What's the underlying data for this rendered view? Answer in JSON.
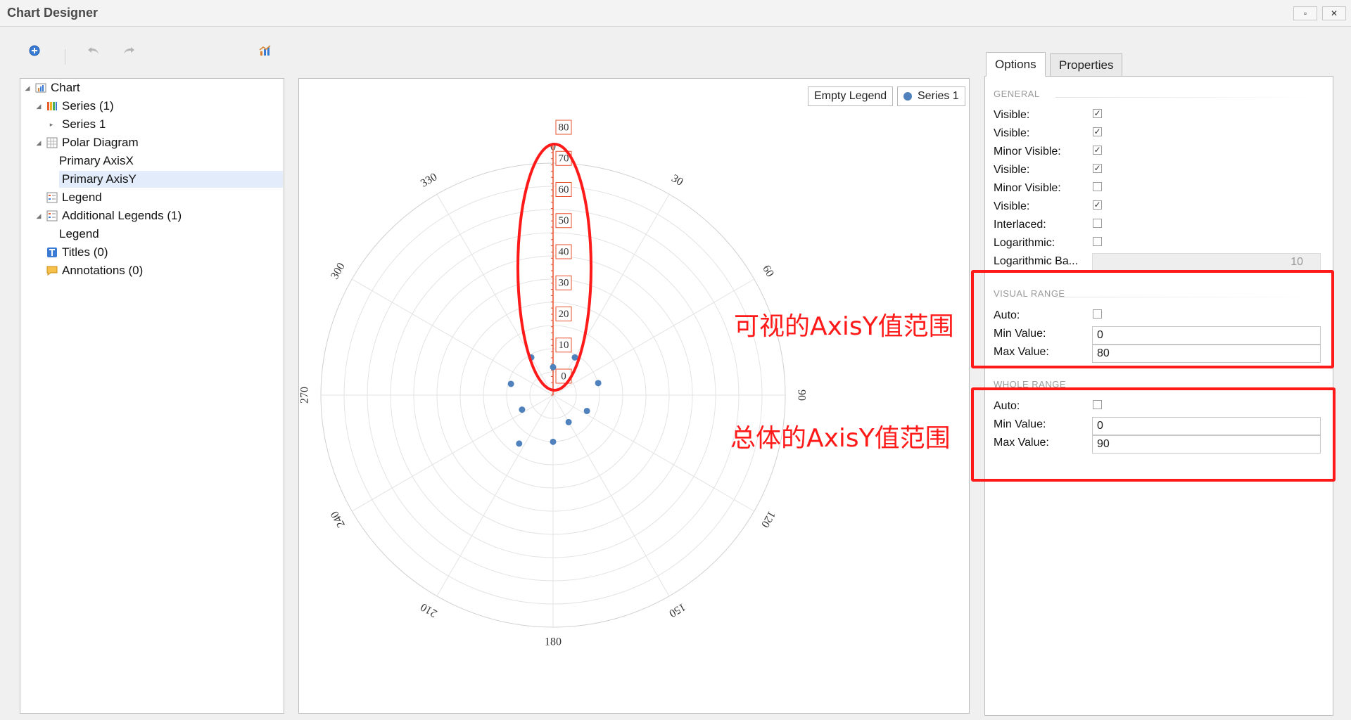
{
  "window": {
    "title": "Chart Designer",
    "restore_glyph": "▫",
    "close_glyph": "✕"
  },
  "toolbar": {
    "icons": [
      "add-icon",
      "undo-icon",
      "redo-icon",
      "chart-wizard-icon"
    ]
  },
  "tree": {
    "items": [
      {
        "label": "Chart",
        "icon": "chart-icon"
      },
      {
        "label": "Series (1)",
        "icon": "series-icon"
      },
      {
        "label": "Series 1",
        "icon": ""
      },
      {
        "label": "Polar Diagram",
        "icon": "diagram-icon"
      },
      {
        "label": "Primary AxisX",
        "icon": ""
      },
      {
        "label": "Primary AxisY",
        "icon": "",
        "selected": true
      },
      {
        "label": "Legend",
        "icon": "legend-icon"
      },
      {
        "label": "Additional Legends (1)",
        "icon": "legend-icon"
      },
      {
        "label": "Legend",
        "icon": ""
      },
      {
        "label": "Titles (0)",
        "icon": "title-icon"
      },
      {
        "label": "Annotations (0)",
        "icon": "annotation-icon"
      }
    ]
  },
  "chart": {
    "empty_legend": "Empty Legend",
    "series_legend": "Series 1",
    "series_color": "#4f81bd"
  },
  "chart_data": {
    "type": "scatter",
    "coordinate_system": "polar",
    "angle_labels": [
      "0",
      "30",
      "60",
      "90",
      "120",
      "150",
      "180",
      "210",
      "240",
      "270",
      "300",
      "330"
    ],
    "radial_labels": [
      "0",
      "10",
      "20",
      "30",
      "40",
      "50",
      "60",
      "70",
      "80"
    ],
    "radial_range": [
      0,
      80
    ],
    "grid": true,
    "legend": "top-right",
    "series": [
      {
        "name": "Series 1",
        "points": [
          {
            "angle": 0,
            "value": 9
          },
          {
            "angle": 30,
            "value": 14
          },
          {
            "angle": 75,
            "value": 15
          },
          {
            "angle": 115,
            "value": 12
          },
          {
            "angle": 150,
            "value": 10
          },
          {
            "angle": 180,
            "value": 15
          },
          {
            "angle": 215,
            "value": 19
          },
          {
            "angle": 245,
            "value": 11
          },
          {
            "angle": 285,
            "value": 14
          },
          {
            "angle": 330,
            "value": 14
          }
        ]
      }
    ]
  },
  "annotations": {
    "visual_range_note": "可视的AxisY值范围",
    "whole_range_note": "总体的AxisY值范围"
  },
  "tabs": {
    "options": "Options",
    "properties": "Properties"
  },
  "options": {
    "general_header": "GENERAL",
    "general_rows": [
      {
        "label": "Visible:",
        "checked": true
      },
      {
        "label": "Visible:",
        "checked": true
      },
      {
        "label": "Minor Visible:",
        "checked": true
      },
      {
        "label": "Visible:",
        "checked": true
      },
      {
        "label": "Minor Visible:",
        "checked": false
      },
      {
        "label": "Visible:",
        "checked": true
      },
      {
        "label": "Interlaced:",
        "checked": false
      },
      {
        "label": "Logarithmic:",
        "checked": false
      }
    ],
    "log_base_label": "Logarithmic Ba...",
    "log_base_value": "10",
    "visual_range": {
      "header": "VISUAL RANGE",
      "auto_label": "Auto:",
      "auto_checked": false,
      "min_label": "Min Value:",
      "min_value": "0",
      "max_label": "Max Value:",
      "max_value": "80"
    },
    "whole_range": {
      "header": "WHOLE RANGE",
      "auto_label": "Auto:",
      "auto_checked": false,
      "min_label": "Min Value:",
      "min_value": "0",
      "max_label": "Max Value:",
      "max_value": "90"
    }
  }
}
